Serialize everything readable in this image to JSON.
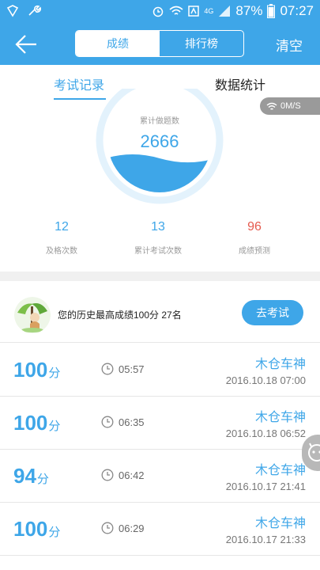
{
  "status_bar": {
    "network": "4G",
    "battery": "87%",
    "time": "07:27"
  },
  "header": {
    "tabs": [
      "成绩",
      "排行榜"
    ],
    "clear_label": "清空"
  },
  "subtabs": {
    "exam_records": "考试记录",
    "data_stats": "数据统计"
  },
  "speed_badge": "0M/S",
  "gauge": {
    "label": "累计做题数",
    "value": "2666"
  },
  "stats": [
    {
      "value": "12",
      "label": "及格次数"
    },
    {
      "value": "13",
      "label": "累计考试次数"
    },
    {
      "value": "96",
      "label": "成绩预测"
    }
  ],
  "history": {
    "text": "您的历史最高成绩100分  27名",
    "button": "去考试"
  },
  "records": [
    {
      "score": "100",
      "unit": "分",
      "duration": "05:57",
      "name": "木仓车神",
      "date": "2016.10.18  07:00"
    },
    {
      "score": "100",
      "unit": "分",
      "duration": "06:35",
      "name": "木仓车神",
      "date": "2016.10.18  06:52"
    },
    {
      "score": "94",
      "unit": "分",
      "duration": "06:42",
      "name": "木仓车神",
      "date": "2016.10.17  21:41"
    },
    {
      "score": "100",
      "unit": "分",
      "duration": "06:29",
      "name": "木仓车神",
      "date": "2016.10.17  21:33"
    }
  ],
  "colors": {
    "accent": "#3ea6e8",
    "prediction": "#e55a4e"
  }
}
